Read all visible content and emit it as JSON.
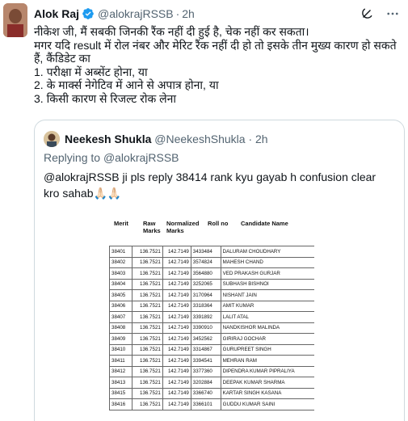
{
  "tweet": {
    "author_name": "Alok Raj",
    "author_handle": "@alokrajRSSB",
    "time": "2h",
    "separator": "·",
    "lines": [
      "नीकेश जी, मैं सबकी जिनकी रैंक नहीं दी हुई है, चेक नहीं कर सकता।",
      "मगर यदि result  में रोल नंबर और मेरिट रैंक नहीं दी हो तो इसके तीन मुख्य कारण हो सकते हैं, कैंडिडेट का",
      "1. परीक्षा में अब्सेंट होना, या",
      "2. के मार्क्स नेगेटिव में आने से अपात्र होना, या",
      "3. किसी कारण से रिजल्ट रोक लेना"
    ]
  },
  "quote": {
    "author_name": "Neekesh Shukla",
    "author_handle": "@NeekeshShukla",
    "time": "2h",
    "separator": "·",
    "replying_label": "Replying to",
    "replying_to": "@alokrajRSSB",
    "text": "@alokrajRSSB ji pls reply 38414 rank kyu gayab h confusion clear kro sahab🙏🏻🙏🏻"
  },
  "result_sheet": {
    "headers": {
      "merit": "Merit",
      "raw": "Raw Marks",
      "normalized": "Normalized Marks",
      "roll": "Roll no",
      "candidate": "Candidate Name"
    },
    "rows": [
      {
        "merit": "38401",
        "raw": "136.7521",
        "norm": "142.7149",
        "roll": "3433484",
        "name": "DALURAM CHOUDHARY"
      },
      {
        "merit": "38402",
        "raw": "136.7521",
        "norm": "142.7149",
        "roll": "3574824",
        "name": "MAHESH CHAND"
      },
      {
        "merit": "38403",
        "raw": "136.7521",
        "norm": "142.7149",
        "roll": "3564880",
        "name": "VED PRAKASH GURJAR"
      },
      {
        "merit": "38404",
        "raw": "136.7521",
        "norm": "142.7149",
        "roll": "3252065",
        "name": "SUBHASH BISHNOI"
      },
      {
        "merit": "38405",
        "raw": "136.7521",
        "norm": "142.7149",
        "roll": "3170964",
        "name": "NISHANT JAIN"
      },
      {
        "merit": "38406",
        "raw": "136.7521",
        "norm": "142.7149",
        "roll": "3318364",
        "name": "AMIT KUMAR"
      },
      {
        "merit": "38407",
        "raw": "136.7521",
        "norm": "142.7149",
        "roll": "3391892",
        "name": "LALIT ATAL"
      },
      {
        "merit": "38408",
        "raw": "136.7521",
        "norm": "142.7149",
        "roll": "3390910",
        "name": "NANDKISHOR MALINDA"
      },
      {
        "merit": "38409",
        "raw": "136.7521",
        "norm": "142.7149",
        "roll": "3452562",
        "name": "GIRIRAJ GOCHAR"
      },
      {
        "merit": "38410",
        "raw": "136.7521",
        "norm": "142.7149",
        "roll": "3314867",
        "name": "GURUPREET SINGH"
      },
      {
        "merit": "38411",
        "raw": "136.7521",
        "norm": "142.7149",
        "roll": "3394541",
        "name": "MEHRAN RAM"
      },
      {
        "merit": "38412",
        "raw": "136.7521",
        "norm": "142.7149",
        "roll": "3377360",
        "name": "DIPENDRA KUMAR PIPRALIYA"
      },
      {
        "merit": "38413",
        "raw": "136.7521",
        "norm": "142.7149",
        "roll": "3202884",
        "name": "DEEPAK KUMAR SHARMA"
      },
      {
        "merit": "38415",
        "raw": "136.7521",
        "norm": "142.7149",
        "roll": "3366740",
        "name": "KARTAR SINGH KASANA"
      },
      {
        "merit": "38416",
        "raw": "136.7521",
        "norm": "142.7149",
        "roll": "3366101",
        "name": "GUDDU KUMAR SAINI"
      }
    ]
  },
  "icons": {
    "verified": "verified-badge-icon",
    "grok": "grok-icon",
    "more": "more-options-icon"
  },
  "colors": {
    "verified_blue": "#1d9bf0",
    "secondary_text": "#536471",
    "border": "#cfd9de"
  }
}
